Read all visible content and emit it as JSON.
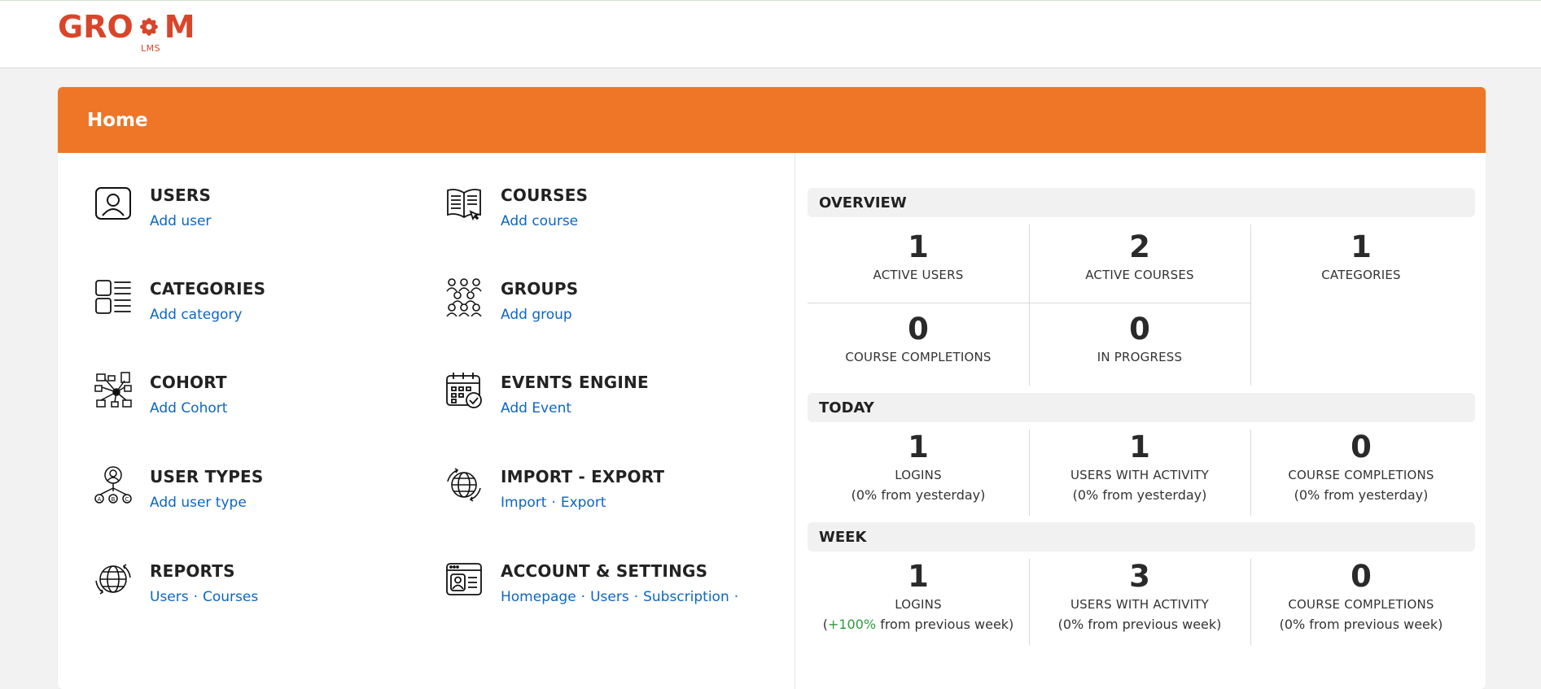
{
  "logo": {
    "text_left": "GRO",
    "text_right": "M",
    "sub": "LMS",
    "brand_color": "#d9452a"
  },
  "page": {
    "title": "Home",
    "accent": "#ef7627",
    "link_color": "#0d66c2"
  },
  "tiles": [
    {
      "title": "USERS",
      "icon": "user-card-icon",
      "links": [
        "Add user"
      ]
    },
    {
      "title": "COURSES",
      "icon": "open-book-icon",
      "links": [
        "Add course"
      ]
    },
    {
      "title": "CATEGORIES",
      "icon": "category-list-icon",
      "links": [
        "Add category"
      ]
    },
    {
      "title": "GROUPS",
      "icon": "people-group-icon",
      "links": [
        "Add group"
      ]
    },
    {
      "title": "COHORT",
      "icon": "cohort-network-icon",
      "links": [
        "Add Cohort"
      ]
    },
    {
      "title": "EVENTS ENGINE",
      "icon": "calendar-check-icon",
      "links": [
        "Add Event"
      ]
    },
    {
      "title": "USER TYPES",
      "icon": "user-types-icon",
      "links": [
        "Add user type"
      ]
    },
    {
      "title": "IMPORT - EXPORT",
      "icon": "globe-arrows-icon",
      "links": [
        "Import",
        "Export"
      ]
    },
    {
      "title": "REPORTS",
      "icon": "globe-report-icon",
      "links": [
        "Users",
        "Courses"
      ]
    },
    {
      "title": "ACCOUNT & SETTINGS",
      "icon": "account-settings-icon",
      "links": [
        "Homepage",
        "Users",
        "Subscription"
      ],
      "trailing_sep": "·"
    }
  ],
  "separator": "·",
  "overview": {
    "title": "OVERVIEW",
    "stats": [
      {
        "value": "1",
        "label": "ACTIVE USERS"
      },
      {
        "value": "2",
        "label": "ACTIVE COURSES"
      },
      {
        "value": "1",
        "label": "CATEGORIES"
      },
      {
        "value": "0",
        "label": "COURSE COMPLETIONS"
      },
      {
        "value": "0",
        "label": "IN PROGRESS"
      }
    ]
  },
  "today": {
    "title": "TODAY",
    "stats": [
      {
        "value": "1",
        "label": "LOGINS",
        "sub": "(0% from yesterday)"
      },
      {
        "value": "1",
        "label": "USERS WITH ACTIVITY",
        "sub": "(0% from yesterday)"
      },
      {
        "value": "0",
        "label": "COURSE COMPLETIONS",
        "sub": "(0% from yesterday)"
      }
    ]
  },
  "week": {
    "title": "WEEK",
    "stats": [
      {
        "value": "1",
        "label": "LOGINS",
        "sub_open": "(",
        "sub_highlight": "+100%",
        "sub_rest": " from previous week)",
        "highlight_color": "#2e9b3a"
      },
      {
        "value": "3",
        "label": "USERS WITH ACTIVITY",
        "sub": "(0% from previous week)"
      },
      {
        "value": "0",
        "label": "COURSE COMPLETIONS",
        "sub": "(0% from previous week)"
      }
    ]
  }
}
